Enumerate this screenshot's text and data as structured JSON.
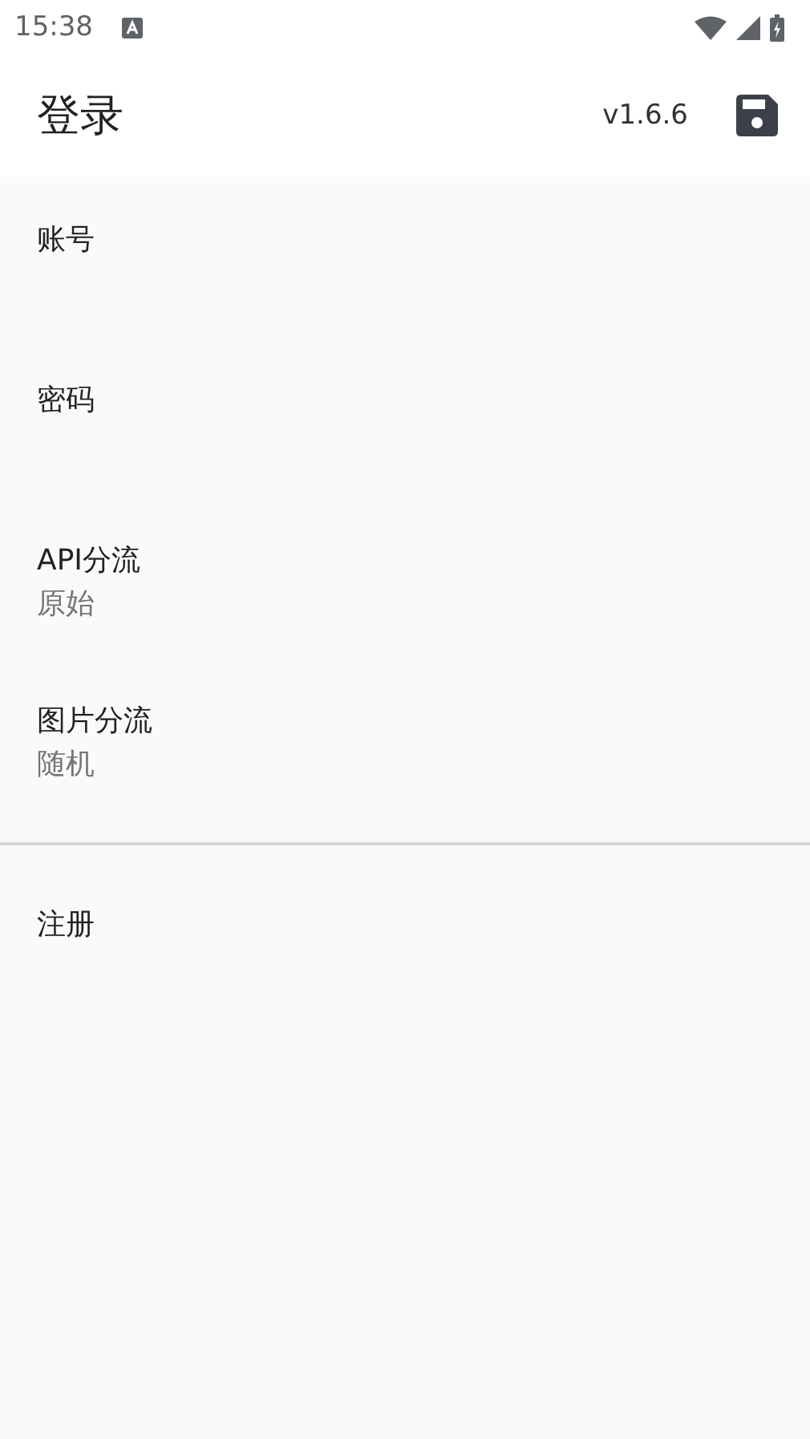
{
  "status_bar": {
    "time": "15:38"
  },
  "app_bar": {
    "title": "登录",
    "version": "v1.6.6"
  },
  "preferences": [
    {
      "title": "账号"
    },
    {
      "title": "密码"
    },
    {
      "title": "API分流",
      "summary": "原始"
    },
    {
      "title": "图片分流",
      "summary": "随机"
    }
  ],
  "actions": [
    {
      "title": "注册"
    }
  ]
}
